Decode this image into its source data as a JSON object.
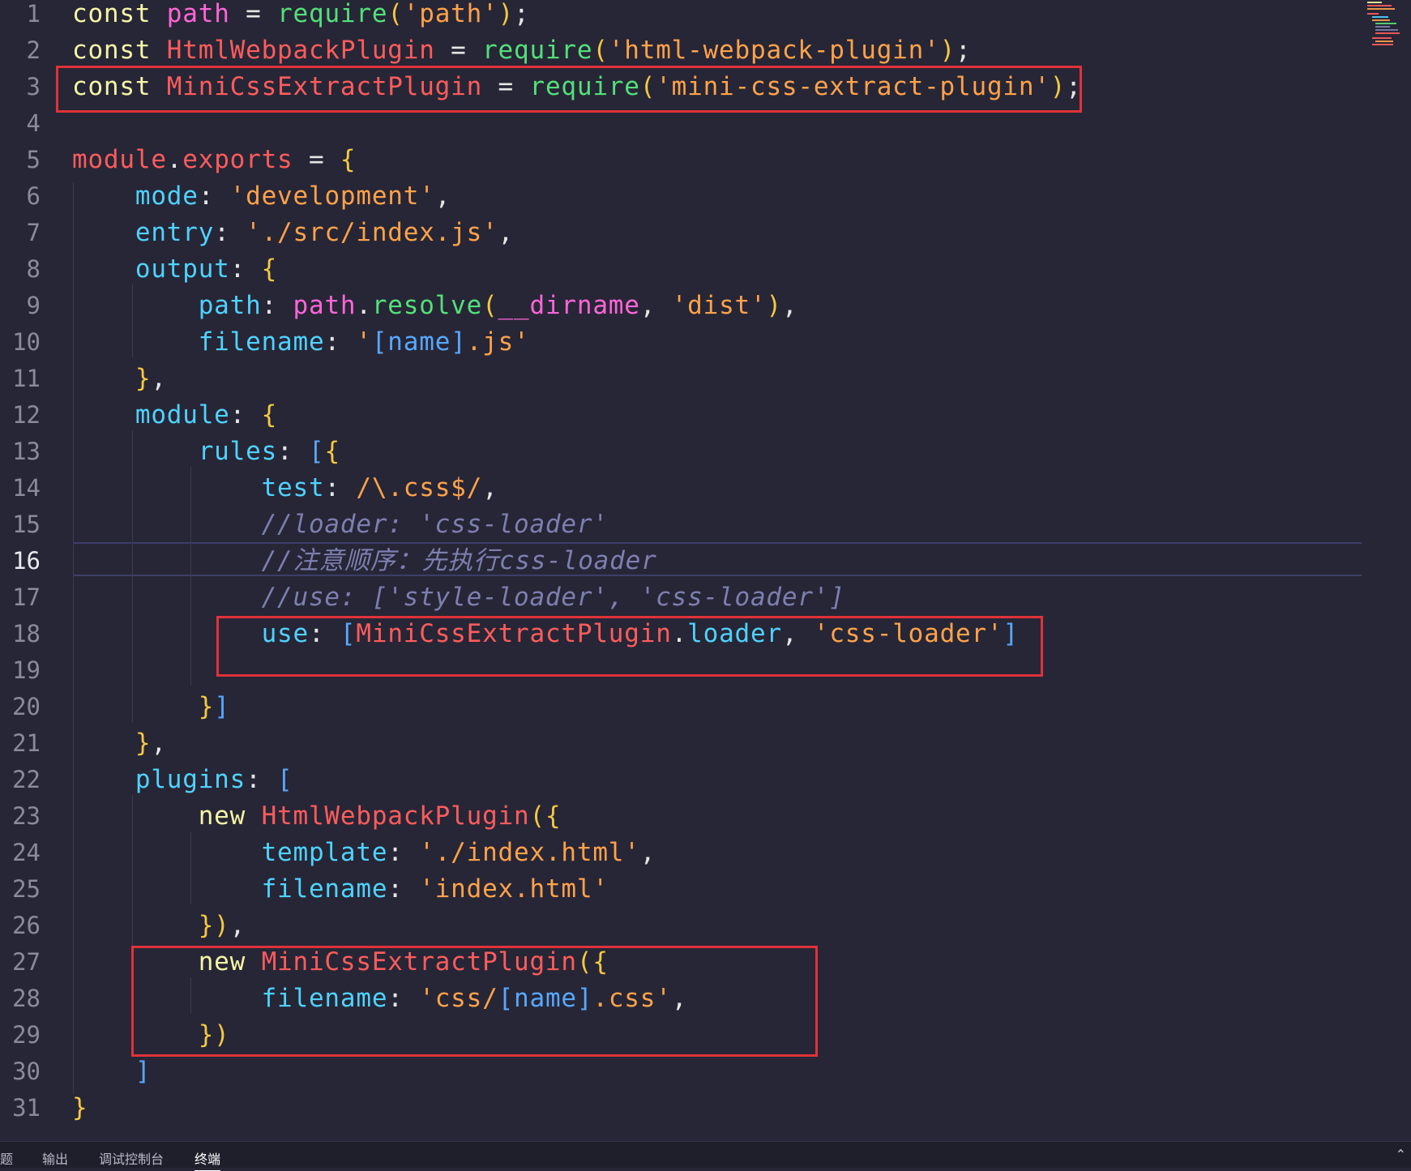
{
  "editor": {
    "language": "javascript",
    "active_line": 16,
    "lines": [
      {
        "n": "1",
        "tokens": [
          [
            "const ",
            "kw"
          ],
          [
            "path",
            "var"
          ],
          [
            " = ",
            "pun"
          ],
          [
            "require",
            "fn"
          ],
          [
            "(",
            "par"
          ],
          [
            "'path'",
            "str"
          ],
          [
            ")",
            "par"
          ],
          [
            ";",
            "pun"
          ]
        ]
      },
      {
        "n": "2",
        "tokens": [
          [
            "const ",
            "kw"
          ],
          [
            "HtmlWebpackPlugin",
            "cls"
          ],
          [
            " = ",
            "pun"
          ],
          [
            "require",
            "fn"
          ],
          [
            "(",
            "par"
          ],
          [
            "'html-webpack-plugin'",
            "str"
          ],
          [
            ")",
            "par"
          ],
          [
            ";",
            "pun"
          ]
        ]
      },
      {
        "n": "3",
        "tokens": [
          [
            "const ",
            "kw"
          ],
          [
            "MiniCssExtractPlugin",
            "cls"
          ],
          [
            " = ",
            "pun"
          ],
          [
            "require",
            "fn"
          ],
          [
            "(",
            "par"
          ],
          [
            "'mini-css-extract-plugin'",
            "str"
          ],
          [
            ")",
            "par"
          ],
          [
            ";",
            "pun"
          ]
        ]
      },
      {
        "n": "4",
        "tokens": []
      },
      {
        "n": "5",
        "tokens": [
          [
            "module",
            "cls"
          ],
          [
            ".",
            "pun"
          ],
          [
            "exports",
            "cls"
          ],
          [
            " = ",
            "pun"
          ],
          [
            "{",
            "par"
          ]
        ]
      },
      {
        "n": "6",
        "tokens": [
          [
            "    ",
            "pun"
          ],
          [
            "mode",
            "prop"
          ],
          [
            ": ",
            "pun"
          ],
          [
            "'development'",
            "str"
          ],
          [
            ",",
            "pun"
          ]
        ]
      },
      {
        "n": "7",
        "tokens": [
          [
            "    ",
            "pun"
          ],
          [
            "entry",
            "prop"
          ],
          [
            ": ",
            "pun"
          ],
          [
            "'./src/index.js'",
            "str"
          ],
          [
            ",",
            "pun"
          ]
        ]
      },
      {
        "n": "8",
        "tokens": [
          [
            "    ",
            "pun"
          ],
          [
            "output",
            "prop"
          ],
          [
            ": ",
            "pun"
          ],
          [
            "{",
            "par"
          ]
        ]
      },
      {
        "n": "9",
        "tokens": [
          [
            "        ",
            "pun"
          ],
          [
            "path",
            "prop"
          ],
          [
            ": ",
            "pun"
          ],
          [
            "path",
            "var"
          ],
          [
            ".",
            "pun"
          ],
          [
            "resolve",
            "fn"
          ],
          [
            "(",
            "par"
          ],
          [
            "__dirname",
            "var"
          ],
          [
            ", ",
            "pun"
          ],
          [
            "'dist'",
            "str"
          ],
          [
            ")",
            "par"
          ],
          [
            ",",
            "pun"
          ]
        ]
      },
      {
        "n": "10",
        "tokens": [
          [
            "        ",
            "pun"
          ],
          [
            "filename",
            "prop"
          ],
          [
            ": ",
            "pun"
          ],
          [
            "'",
            "str"
          ],
          [
            "[name]",
            "brk"
          ],
          [
            ".js'",
            "str"
          ]
        ]
      },
      {
        "n": "11",
        "tokens": [
          [
            "    ",
            "pun"
          ],
          [
            "}",
            "par"
          ],
          [
            ",",
            "pun"
          ]
        ]
      },
      {
        "n": "12",
        "tokens": [
          [
            "    ",
            "pun"
          ],
          [
            "module",
            "prop"
          ],
          [
            ": ",
            "pun"
          ],
          [
            "{",
            "par"
          ]
        ]
      },
      {
        "n": "13",
        "tokens": [
          [
            "        ",
            "pun"
          ],
          [
            "rules",
            "prop"
          ],
          [
            ": ",
            "pun"
          ],
          [
            "[",
            "brk"
          ],
          [
            "{",
            "par"
          ]
        ]
      },
      {
        "n": "14",
        "tokens": [
          [
            "            ",
            "pun"
          ],
          [
            "test",
            "prop"
          ],
          [
            ": ",
            "pun"
          ],
          [
            "/\\.css$/",
            "str"
          ],
          [
            ",",
            "pun"
          ]
        ]
      },
      {
        "n": "15",
        "tokens": [
          [
            "            ",
            "pun"
          ],
          [
            "//loader: 'css-loader'",
            "cmt"
          ]
        ]
      },
      {
        "n": "16",
        "tokens": [
          [
            "            ",
            "pun"
          ],
          [
            "//注意顺序：先执行css-loader",
            "cmt"
          ]
        ]
      },
      {
        "n": "17",
        "tokens": [
          [
            "            ",
            "pun"
          ],
          [
            "//use: ['style-loader', 'css-loader']",
            "cmt"
          ]
        ]
      },
      {
        "n": "18",
        "tokens": [
          [
            "            ",
            "pun"
          ],
          [
            "use",
            "prop"
          ],
          [
            ": ",
            "pun"
          ],
          [
            "[",
            "brk"
          ],
          [
            "MiniCssExtractPlugin",
            "cls"
          ],
          [
            ".",
            "pun"
          ],
          [
            "loader",
            "prop"
          ],
          [
            ", ",
            "pun"
          ],
          [
            "'css-loader'",
            "str"
          ],
          [
            "]",
            "brk"
          ]
        ]
      },
      {
        "n": "19",
        "tokens": []
      },
      {
        "n": "20",
        "tokens": [
          [
            "        ",
            "pun"
          ],
          [
            "}",
            "par"
          ],
          [
            "]",
            "brk"
          ]
        ]
      },
      {
        "n": "21",
        "tokens": [
          [
            "    ",
            "pun"
          ],
          [
            "}",
            "par"
          ],
          [
            ",",
            "pun"
          ]
        ]
      },
      {
        "n": "22",
        "tokens": [
          [
            "    ",
            "pun"
          ],
          [
            "plugins",
            "prop"
          ],
          [
            ": ",
            "pun"
          ],
          [
            "[",
            "brk"
          ]
        ]
      },
      {
        "n": "23",
        "tokens": [
          [
            "        ",
            "pun"
          ],
          [
            "new ",
            "kw"
          ],
          [
            "HtmlWebpackPlugin",
            "cls"
          ],
          [
            "(",
            "par"
          ],
          [
            "{",
            "par"
          ]
        ]
      },
      {
        "n": "24",
        "tokens": [
          [
            "            ",
            "pun"
          ],
          [
            "template",
            "prop"
          ],
          [
            ": ",
            "pun"
          ],
          [
            "'./index.html'",
            "str"
          ],
          [
            ",",
            "pun"
          ]
        ]
      },
      {
        "n": "25",
        "tokens": [
          [
            "            ",
            "pun"
          ],
          [
            "filename",
            "prop"
          ],
          [
            ": ",
            "pun"
          ],
          [
            "'index.html'",
            "str"
          ]
        ]
      },
      {
        "n": "26",
        "tokens": [
          [
            "        ",
            "pun"
          ],
          [
            "})",
            "par"
          ],
          [
            ",",
            "pun"
          ]
        ]
      },
      {
        "n": "27",
        "tokens": [
          [
            "        ",
            "pun"
          ],
          [
            "new ",
            "kw"
          ],
          [
            "MiniCssExtractPlugin",
            "cls"
          ],
          [
            "(",
            "par"
          ],
          [
            "{",
            "par"
          ]
        ]
      },
      {
        "n": "28",
        "tokens": [
          [
            "            ",
            "pun"
          ],
          [
            "filename",
            "prop"
          ],
          [
            ": ",
            "pun"
          ],
          [
            "'css/",
            "str"
          ],
          [
            "[name]",
            "brk"
          ],
          [
            ".css'",
            "str"
          ],
          [
            ",",
            "pun"
          ]
        ]
      },
      {
        "n": "29",
        "tokens": [
          [
            "        ",
            "pun"
          ],
          [
            "})",
            "par"
          ]
        ]
      },
      {
        "n": "30",
        "tokens": [
          [
            "    ",
            "pun"
          ],
          [
            "]",
            "brk"
          ]
        ]
      },
      {
        "n": "31",
        "tokens": [
          [
            "}",
            "par"
          ]
        ]
      }
    ]
  },
  "panel": {
    "tabs": [
      "题",
      "输出",
      "调试控制台",
      "终端"
    ],
    "active_tab": "终端",
    "collapse_icon": "chevron-up-icon"
  },
  "colors": {
    "background": "#272636",
    "highlight_box": "#e0323a",
    "current_line_border": "#3d3d6b"
  }
}
